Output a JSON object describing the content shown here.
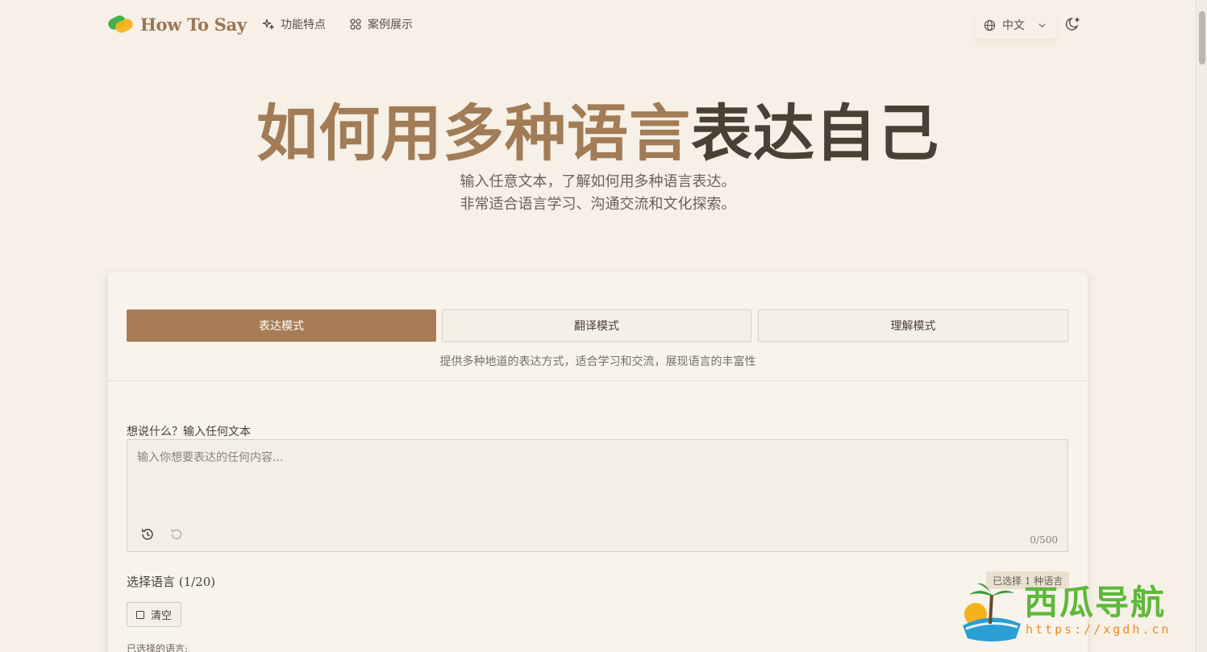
{
  "header": {
    "logo_text": "How To Say",
    "nav": [
      {
        "label": "功能特点",
        "icon": "sparkles-icon"
      },
      {
        "label": "案例展示",
        "icon": "grid-icon"
      }
    ],
    "language": "中文",
    "theme_icon": "moon-icon"
  },
  "hero": {
    "title_part1": "如何用多种语言",
    "title_part2": "表达自己",
    "subtitle_line1": "输入任意文本，了解如何用多种语言表达。",
    "subtitle_line2": "非常适合语言学习、沟通交流和文化探索。"
  },
  "modes": {
    "express": "表达模式",
    "translate": "翻译模式",
    "understand": "理解模式",
    "active": "express",
    "description": "提供多种地道的表达方式，适合学习和交流，展现语言的丰富性"
  },
  "input": {
    "label": "想说什么？输入任何文本",
    "placeholder": "输入你想要表达的任何内容...",
    "counter": "0/500"
  },
  "languages": {
    "label": "选择语言 (1/20)",
    "selected_badge": "已选择 1 种语言",
    "clear_label": "清空",
    "selected_label": "已选择的语言:"
  },
  "watermark": {
    "title": "西瓜导航",
    "url": "https://xgdh.cn"
  },
  "colors": {
    "accent": "#a87c55",
    "background": "#f6f0e6",
    "title_accent": "#a17c56"
  }
}
